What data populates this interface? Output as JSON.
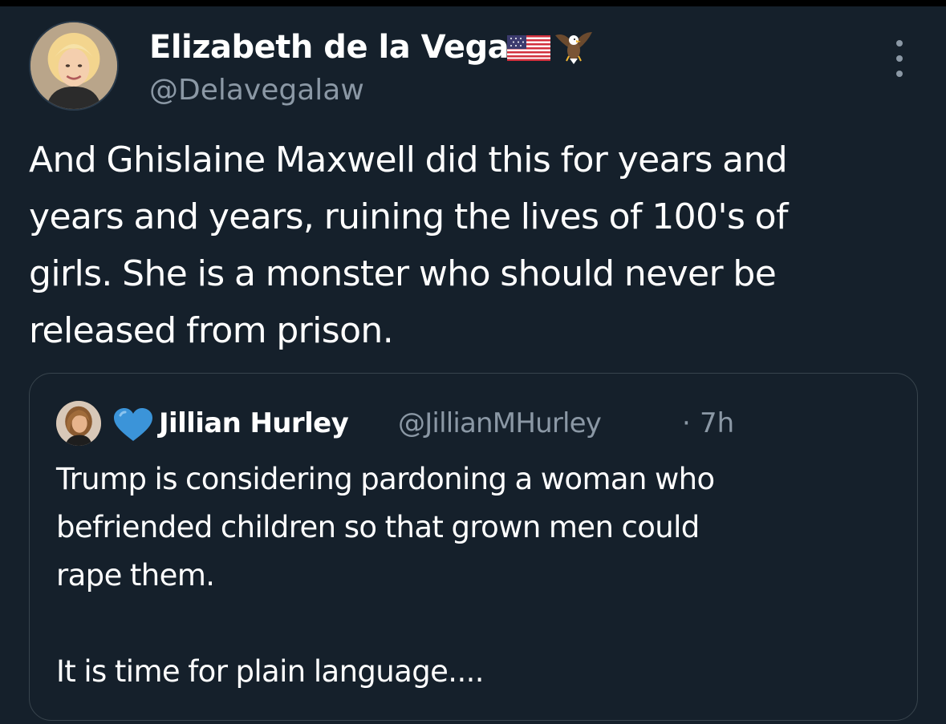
{
  "tweet": {
    "author": {
      "name": "Elizabeth de la Vega",
      "handle": "@Delavegalaw",
      "name_emojis": [
        "us-flag-icon",
        "eagle-icon"
      ]
    },
    "text_lines": [
      "And Ghislaine Maxwell did this for years and",
      "years and years, ruining the lives of 100's of",
      "girls. She is a monster who should never be",
      "released from prison."
    ]
  },
  "quoted_tweet": {
    "author": {
      "name_prefix_emoji": "blue-heart-icon",
      "name": "Jillian Hurley",
      "handle": "@JillianMHurley",
      "separator": "·",
      "time": "7h"
    },
    "text_lines": [
      "Trump is considering pardoning a woman who",
      "befriended children so that grown men could",
      "rape them.",
      "",
      "It is time for plain language...."
    ]
  },
  "colors": {
    "background": "#15202b",
    "text_primary": "#ffffff",
    "text_secondary": "#8b98a5",
    "card_border": "#38444d",
    "heart": "#3b94d9"
  }
}
